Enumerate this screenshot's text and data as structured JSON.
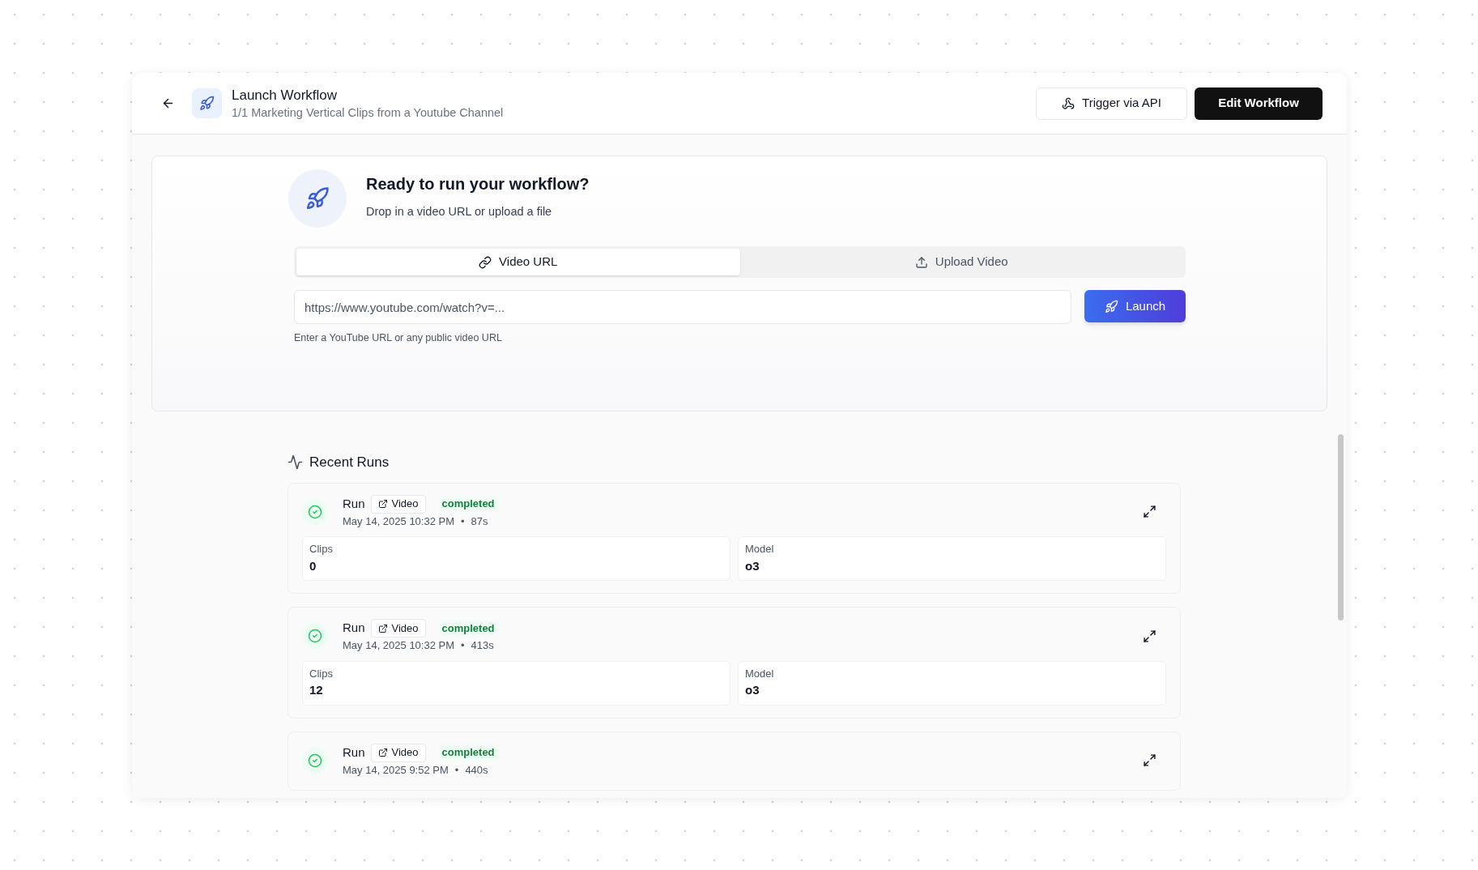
{
  "header": {
    "title": "Launch Workflow",
    "subtitle": "1/1 Marketing Vertical Clips from a Youtube Channel",
    "buttons": [
      {
        "label": "Trigger via API",
        "kind": "outline"
      },
      {
        "label": "Edit Workflow",
        "kind": "primary"
      }
    ]
  },
  "launch": {
    "heading": "Ready to run your workflow?",
    "description": "Drop in a video URL or upload a file",
    "tabs": [
      {
        "label": "Video URL",
        "kind": "link",
        "selected": true
      },
      {
        "label": "Upload Video",
        "kind": "upload",
        "selected": false
      }
    ],
    "url_field": {
      "placeholder": "https://www.youtube.com/watch?v=..."
    },
    "button": "Launch",
    "hint": "Enter a YouTube URL or any public video URL"
  },
  "recent_runs": {
    "title": "Recent Runs",
    "runs": [
      {
        "name": "Run",
        "link": "Video",
        "status": "completed",
        "date": "May 14, 2025 10:32 PM",
        "separator": "•",
        "duration": "87s",
        "stats": [
          {
            "label": "Clips",
            "value": "0"
          },
          {
            "label": "Model",
            "value": "o3"
          }
        ]
      },
      {
        "name": "Run",
        "link": "Video",
        "status": "completed",
        "date": "May 14, 2025 10:32 PM",
        "separator": "•",
        "duration": "413s",
        "stats": [
          {
            "label": "Clips",
            "value": "12"
          },
          {
            "label": "Model",
            "value": "o3"
          }
        ]
      },
      {
        "name": "Run",
        "link": "Video",
        "status": "completed",
        "date": "May 14, 2025 9:52 PM",
        "separator": "•",
        "duration": "440s"
      }
    ]
  }
}
